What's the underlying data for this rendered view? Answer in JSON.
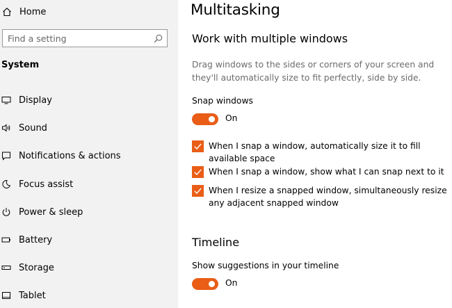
{
  "sidebar": {
    "home_label": "Home",
    "search_placeholder": "Find a setting",
    "section_title": "System",
    "items": [
      {
        "label": "Display",
        "icon": "monitor-icon"
      },
      {
        "label": "Sound",
        "icon": "speaker-icon"
      },
      {
        "label": "Notifications & actions",
        "icon": "notification-icon"
      },
      {
        "label": "Focus assist",
        "icon": "moon-icon"
      },
      {
        "label": "Power & sleep",
        "icon": "power-icon"
      },
      {
        "label": "Battery",
        "icon": "battery-icon"
      },
      {
        "label": "Storage",
        "icon": "storage-icon"
      },
      {
        "label": "Tablet",
        "icon": "tablet-icon"
      }
    ]
  },
  "main": {
    "title": "Multitasking",
    "section1": {
      "heading": "Work with multiple windows",
      "description": "Drag windows to the sides or corners of your screen and they'll automatically size to fit perfectly, side by side.",
      "snap_label": "Snap windows",
      "snap_state": "On",
      "checkboxes": [
        {
          "label": "When I snap a window, automatically size it to fill available space",
          "checked": true
        },
        {
          "label": "When I snap a window, show what I can snap next to it",
          "checked": true
        },
        {
          "label": "When I resize a snapped window, simultaneously resize any adjacent snapped window",
          "checked": true
        }
      ]
    },
    "section2": {
      "heading": "Timeline",
      "suggestions_label": "Show suggestions in your timeline",
      "suggestions_state": "On"
    }
  },
  "colors": {
    "accent": "#e95d17",
    "sidebar_bg": "#f2f2f2",
    "description_text": "#6b6b6b"
  }
}
